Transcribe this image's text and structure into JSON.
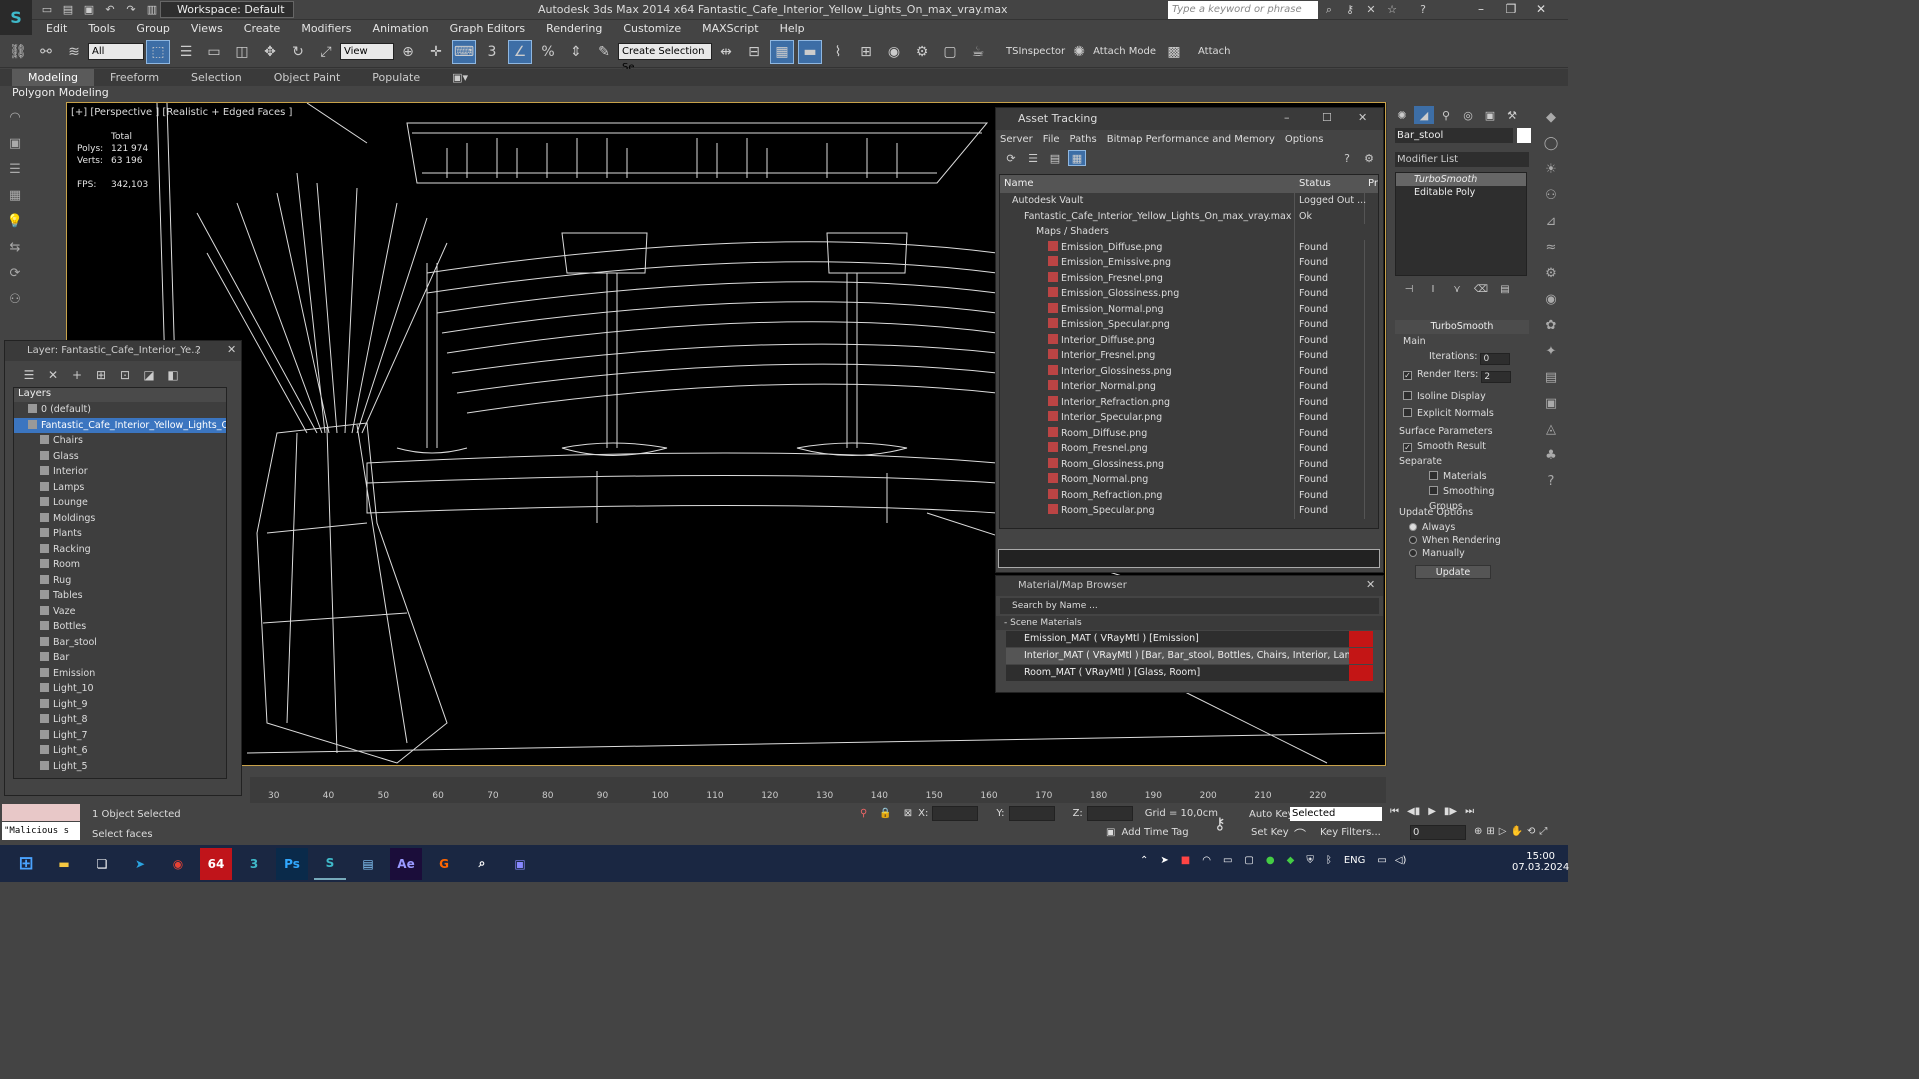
{
  "app": {
    "title": "Autodesk 3ds Max  2014 x64     Fantastic_Cafe_Interior_Yellow_Lights_On_max_vray.max",
    "workspace": "Workspace: Default",
    "search_placeholder": "Type a keyword or phrase"
  },
  "menu": [
    "Edit",
    "Tools",
    "Group",
    "Views",
    "Create",
    "Modifiers",
    "Animation",
    "Graph Editors",
    "Rendering",
    "Customize",
    "MAXScript",
    "Help"
  ],
  "toolbar": {
    "selection_filter": "All",
    "ref_coord": "View",
    "named_selection": "Create Selection Se",
    "ts_inspector": "TSInspector",
    "attach_mode": "Attach Mode",
    "attach": "Attach"
  },
  "ribbon": {
    "tabs": [
      "Modeling",
      "Freeform",
      "Selection",
      "Object Paint",
      "Populate"
    ],
    "sub_label": "Polygon Modeling"
  },
  "viewport": {
    "label": "[+] [Perspective ] [Realistic + Edged Faces ]",
    "stats_header": "Total",
    "polys_label": "Polys:",
    "polys_value": "121 974",
    "verts_label": "Verts:",
    "verts_value": "63 196",
    "fps_label": "FPS:",
    "fps_value": "342,103"
  },
  "layer_dialog": {
    "title": "Layer: Fantastic_Cafe_Interior_Ye...",
    "header": "Layers",
    "default_layer": "0 (default)",
    "active_layer": "Fantastic_Cafe_Interior_Yellow_Lights_On",
    "children": [
      "Chairs",
      "Glass",
      "Interior",
      "Lamps",
      "Lounge",
      "Moldings",
      "Plants",
      "Racking",
      "Room",
      "Rug",
      "Tables",
      "Vaze",
      "Bottles",
      "Bar_stool",
      "Bar",
      "Emission",
      "Light_10",
      "Light_9",
      "Light_8",
      "Light_7",
      "Light_6",
      "Light_5"
    ]
  },
  "asset_tracking": {
    "title": "Asset Tracking",
    "menu": [
      "Server",
      "File",
      "Paths",
      "Bitmap Performance and Memory",
      "Options"
    ],
    "col_name": "Name",
    "col_status": "Status",
    "col_extra": "Pr",
    "rows": [
      {
        "name": "Autodesk Vault",
        "status": "Logged Out ...",
        "indent": 1
      },
      {
        "name": "Fantastic_Cafe_Interior_Yellow_Lights_On_max_vray.max",
        "status": "Ok",
        "indent": 2
      },
      {
        "name": "Maps / Shaders",
        "status": "",
        "indent": 3
      },
      {
        "name": "Emission_Diffuse.png",
        "status": "Found",
        "indent": 4
      },
      {
        "name": "Emission_Emissive.png",
        "status": "Found",
        "indent": 4
      },
      {
        "name": "Emission_Fresnel.png",
        "status": "Found",
        "indent": 4
      },
      {
        "name": "Emission_Glossiness.png",
        "status": "Found",
        "indent": 4
      },
      {
        "name": "Emission_Normal.png",
        "status": "Found",
        "indent": 4
      },
      {
        "name": "Emission_Specular.png",
        "status": "Found",
        "indent": 4
      },
      {
        "name": "Interior_Diffuse.png",
        "status": "Found",
        "indent": 4
      },
      {
        "name": "Interior_Fresnel.png",
        "status": "Found",
        "indent": 4
      },
      {
        "name": "Interior_Glossiness.png",
        "status": "Found",
        "indent": 4
      },
      {
        "name": "Interior_Normal.png",
        "status": "Found",
        "indent": 4
      },
      {
        "name": "Interior_Refraction.png",
        "status": "Found",
        "indent": 4
      },
      {
        "name": "Interior_Specular.png",
        "status": "Found",
        "indent": 4
      },
      {
        "name": "Room_Diffuse.png",
        "status": "Found",
        "indent": 4
      },
      {
        "name": "Room_Fresnel.png",
        "status": "Found",
        "indent": 4
      },
      {
        "name": "Room_Glossiness.png",
        "status": "Found",
        "indent": 4
      },
      {
        "name": "Room_Normal.png",
        "status": "Found",
        "indent": 4
      },
      {
        "name": "Room_Refraction.png",
        "status": "Found",
        "indent": 4
      },
      {
        "name": "Room_Specular.png",
        "status": "Found",
        "indent": 4
      }
    ]
  },
  "material_browser": {
    "title": "Material/Map Browser",
    "search_placeholder": "Search by Name ...",
    "section": "- Scene Materials",
    "materials": [
      "Emission_MAT  ( VRayMtl )  [Emission]",
      "Interior_MAT  ( VRayMtl )  [Bar, Bar_stool, Bottles, Chairs, Interior, Lamps, Loun...",
      "Room_MAT  ( VRayMtl )  [Glass, Room]"
    ]
  },
  "command_panel": {
    "object_name": "Bar_stool",
    "modifier_list": "Modifier List",
    "stack": [
      "TurboSmooth",
      "Editable Poly"
    ],
    "turbosmooth_title": "TurboSmooth",
    "main_label": "Main",
    "iterations_label": "Iterations:",
    "iterations_value": "0",
    "render_iters_label": "Render Iters:",
    "render_iters_value": "2",
    "isoline": "Isoline Display",
    "explicit_normals": "Explicit Normals",
    "surface_params": "Surface Parameters",
    "smooth_result": "Smooth Result",
    "separate": "Separate",
    "materials": "Materials",
    "smoothing_groups": "Smoothing Groups",
    "update_options": "Update Options",
    "always": "Always",
    "when_rendering": "When Rendering",
    "manually": "Manually",
    "update_btn": "Update"
  },
  "timeline": {
    "ticks": [
      "30",
      "40",
      "50",
      "60",
      "70",
      "80",
      "90",
      "100",
      "110",
      "120",
      "130",
      "140",
      "150",
      "160",
      "170",
      "180",
      "190",
      "200",
      "210",
      "220"
    ]
  },
  "status": {
    "maxscript": "\"Malicious s",
    "selected_count": "1 Object Selected",
    "prompt": "Select faces",
    "x_label": "X:",
    "y_label": "Y:",
    "z_label": "Z:",
    "grid": "Grid = 10,0cm",
    "add_time_tag": "Add Time Tag",
    "auto_key": "Auto Key",
    "set_key": "Set Key",
    "selected_dropdown": "Selected",
    "key_filters": "Key Filters...",
    "frame_value": "0"
  },
  "taskbar": {
    "lang": "ENG",
    "time": "15:00",
    "date": "07.03.2024"
  }
}
